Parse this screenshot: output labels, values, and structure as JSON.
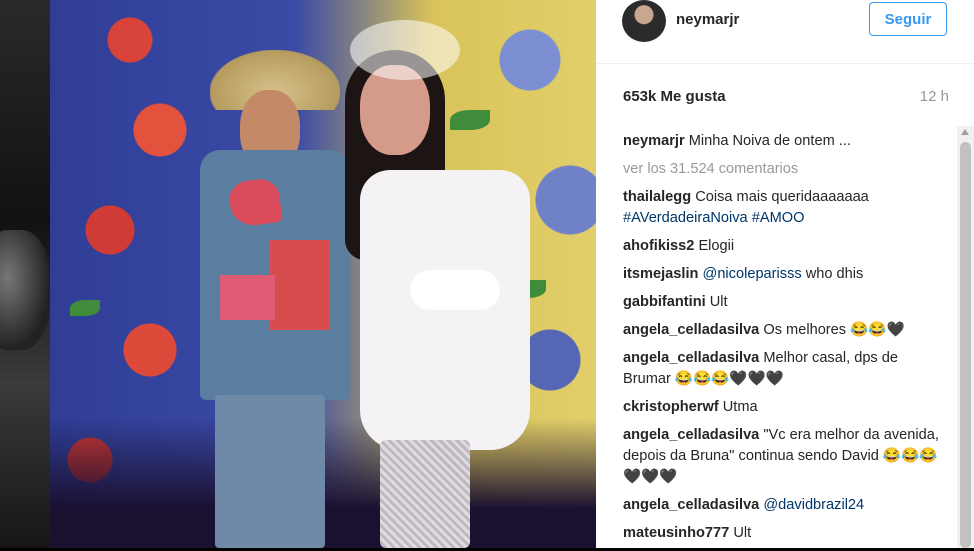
{
  "post": {
    "username": "neymarjr",
    "follow_label": "Seguir",
    "likes": "653k Me gusta",
    "time": "12 h"
  },
  "comments": {
    "caption": {
      "user": "neymarjr",
      "text": "Minha Noiva de ontem ..."
    },
    "view_all": "ver los 31.524 comentarios",
    "items": [
      {
        "user": "thailalegg",
        "text": "Coisa mais queridaaaaaaa",
        "mention": "#AVerdadeiraNoiva #AMOO"
      },
      {
        "user": "ahofikiss2",
        "text": "Elogii"
      },
      {
        "user": "itsmejaslin",
        "mention": "@nicoleparisss",
        "text": "who dhis"
      },
      {
        "user": "gabbifantini",
        "text": "Ult"
      },
      {
        "user": "angela_celladasilva",
        "text": "Os melhores 😂😂🖤"
      },
      {
        "user": "angela_celladasilva",
        "text": "Melhor casal, dps de Brumar 😂😂😂🖤🖤🖤"
      },
      {
        "user": "ckristopherwf",
        "text": "Utma"
      },
      {
        "user": "angela_celladasilva",
        "text": "\"Vc era melhor da avenida, depois da Bruna\" continua sendo David 😂😂😂🖤🖤🖤"
      },
      {
        "user": "angela_celladasilva",
        "mention": "@davidbrazil24"
      },
      {
        "user": "mateusinho777",
        "text": "Ult"
      }
    ]
  },
  "colors": {
    "link": "#3897f0",
    "mention": "#003569",
    "muted": "#999999",
    "text": "#262626"
  }
}
